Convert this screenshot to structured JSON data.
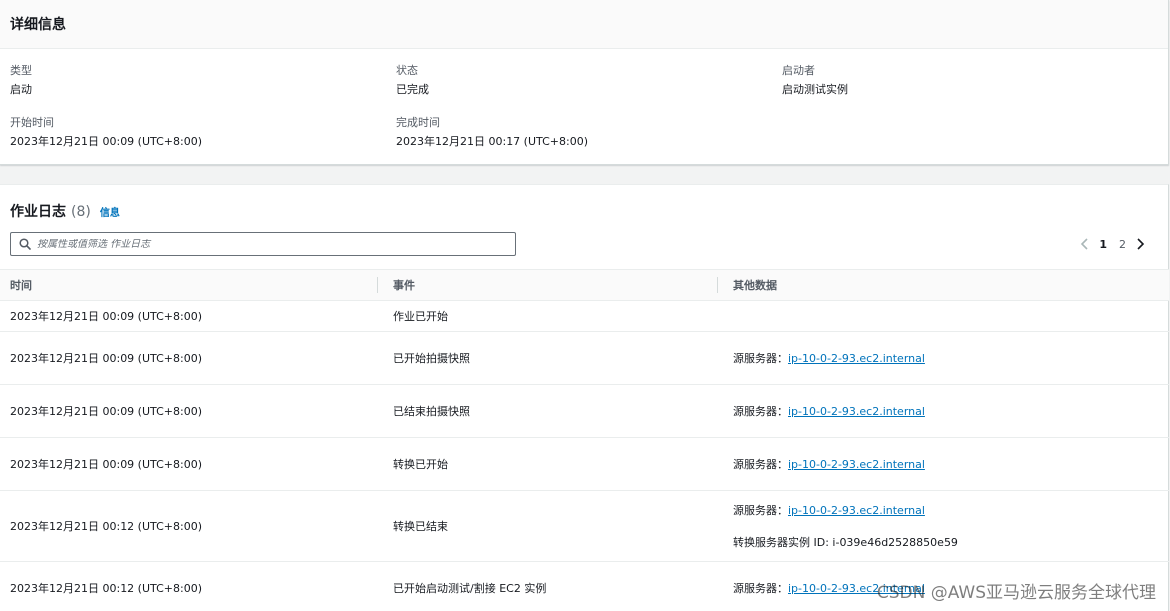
{
  "details": {
    "title": "详细信息",
    "type_label": "类型",
    "type_value": "启动",
    "status_label": "状态",
    "status_value": "已完成",
    "initiator_label": "启动者",
    "initiator_value": "启动测试实例",
    "start_label": "开始时间",
    "start_value": "2023年12月21日 00:09 (UTC+8:00)",
    "end_label": "完成时间",
    "end_value": "2023年12月21日 00:17 (UTC+8:00)"
  },
  "logs": {
    "title": "作业日志",
    "count": "(8)",
    "info_link": "信息",
    "search_placeholder": "按属性或值筛选 作业日志",
    "pagination": {
      "pages": [
        "1",
        "2"
      ],
      "current": "1"
    },
    "columns": [
      "时间",
      "事件",
      "其他数据"
    ],
    "rows": [
      {
        "time": "2023年12月21日 00:09 (UTC+8:00)",
        "event": "作业已开始"
      },
      {
        "time": "2023年12月21日 00:09 (UTC+8:00)",
        "event": "已开始拍摄快照",
        "data_label": "源服务器：",
        "data_link": "ip-10-0-2-93.ec2.internal"
      },
      {
        "time": "2023年12月21日 00:09 (UTC+8:00)",
        "event": "已结束拍摄快照",
        "data_label": "源服务器：",
        "data_link": "ip-10-0-2-93.ec2.internal"
      },
      {
        "time": "2023年12月21日 00:09 (UTC+8:00)",
        "event": "转换已开始",
        "data_label": "源服务器：",
        "data_link": "ip-10-0-2-93.ec2.internal"
      },
      {
        "time": "2023年12月21日 00:12 (UTC+8:00)",
        "event": "转换已结束",
        "data_label": "源服务器：",
        "data_link": "ip-10-0-2-93.ec2.internal",
        "data_extra": "转换服务器实例 ID: i-039e46d2528850e59"
      },
      {
        "time": "2023年12月21日 00:12 (UTC+8:00)",
        "event": "已开始启动测试/割接 EC2 实例",
        "data_label": "源服务器：",
        "data_link": "ip-10-0-2-93.ec2.internal"
      }
    ]
  },
  "watermark": "CSDN @AWS亚马逊云服务全球代理"
}
